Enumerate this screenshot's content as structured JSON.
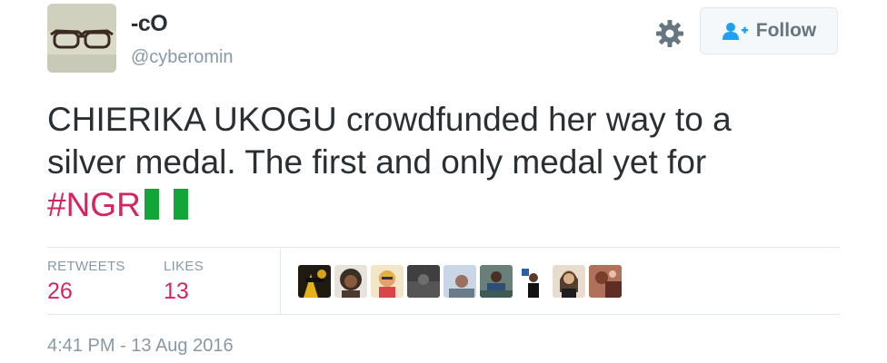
{
  "user": {
    "display_name": "-cO",
    "handle": "@cyberomin",
    "avatar_icon": "glasses-avatar"
  },
  "actions": {
    "settings_icon": "gear-icon",
    "follow_label": "Follow",
    "follow_icon": "add-user-icon"
  },
  "tweet": {
    "text_line1": "CHIERIKA UKOGU crowdfunded her way to a",
    "text_line2": "silver medal. The first and only medal yet for",
    "hashtag": "#NGR",
    "flag_icon": "nigeria-flag-emoji"
  },
  "stats": {
    "retweets_label": "RETWEETS",
    "retweets_value": "26",
    "likes_label": "LIKES",
    "likes_value": "13"
  },
  "likers": [
    "liker-1",
    "liker-2",
    "liker-3",
    "liker-4",
    "liker-5",
    "liker-6",
    "liker-7",
    "liker-8",
    "liker-9"
  ],
  "timestamp": "4:41 PM - 13 Aug 2016",
  "colors": {
    "hashtag": "#d6245e",
    "stat_value": "#d6245e",
    "muted": "#8899a6",
    "text": "#292f33"
  }
}
